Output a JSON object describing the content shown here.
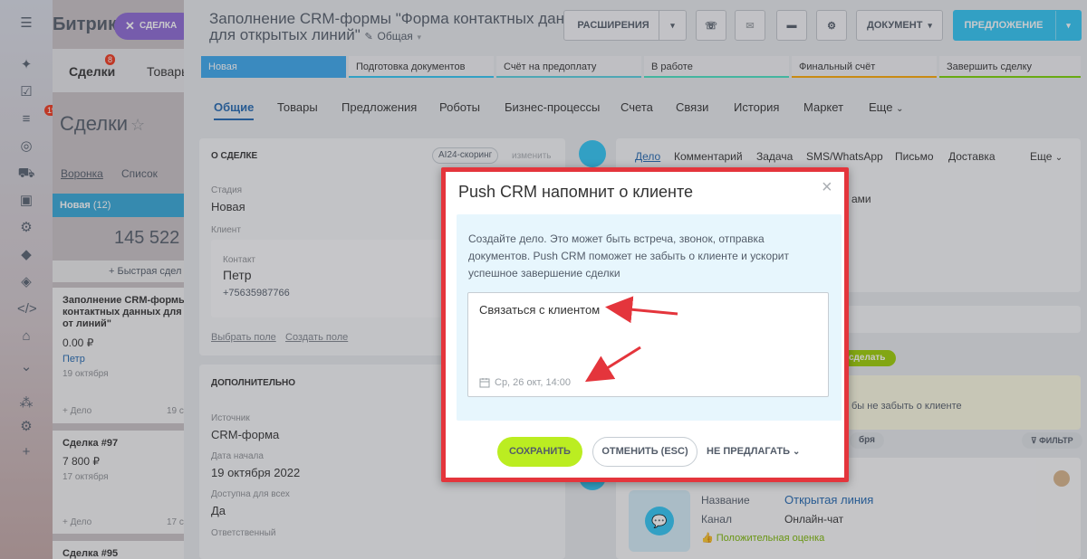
{
  "sidebar": {
    "badge": "19"
  },
  "kanban": {
    "app_name": "Битрикс",
    "deal_chip": "СДЕЛКА",
    "tab_deals": "Сделки",
    "tab_deals_badge": "8",
    "tab_goods": "Товары",
    "page_title": "Сделки",
    "view_funnel": "Воронка",
    "view_list": "Список",
    "column_name": "Новая",
    "column_count": "(12)",
    "column_sum": "145 522",
    "quick_deal": "+ Быстрая сдел",
    "cards": [
      {
        "title": "Заполнение CRM-формы контактных данных для от линий\"",
        "amount": "0.00 ₽",
        "client": "Петр",
        "date": "19 октября",
        "add": "+ Дело",
        "date_short": "19 с"
      },
      {
        "title": "Сделка #97",
        "amount": "7 800 ₽",
        "date": "17 октября",
        "add": "+ Дело",
        "date_short": "17 с"
      },
      {
        "title": "Сделка #95"
      }
    ]
  },
  "header": {
    "title_line1": "Заполнение CRM-формы \"Форма контактных данных",
    "title_line2": "для открытых линий\"",
    "category": "Общая",
    "btn_extensions": "РАСШИРЕНИЯ",
    "btn_document": "ДОКУМЕНТ",
    "btn_proposal": "ПРЕДЛОЖЕНИЕ"
  },
  "stages": [
    "Новая",
    "Подготовка документов",
    "Счёт на предоплату",
    "В работе",
    "Финальный счёт",
    "Завершить сделку"
  ],
  "tabs": [
    "Общие",
    "Товары",
    "Предложения",
    "Роботы",
    "Бизнес-процессы",
    "Счета",
    "Связи",
    "История",
    "Маркет",
    "Еще"
  ],
  "about": {
    "heading": "О СДЕЛКЕ",
    "ai_badge": "AI24-скоринг",
    "edit": "изменить",
    "stage_label": "Стадия",
    "stage_value": "Новая",
    "client_label": "Клиент",
    "contact_label": "Контакт",
    "contact_name": "Петр",
    "contact_phone": "+75635987766",
    "select_field": "Выбрать поле",
    "create_field": "Создать поле"
  },
  "extra": {
    "heading": "ДОПОЛНИТЕЛЬНО",
    "source_label": "Источник",
    "source_value": "CRM-форма",
    "start_label": "Дата начала",
    "start_value": "19 октября 2022",
    "access_label": "Доступна для всех",
    "access_value": "Да",
    "resp_label": "Ответственный"
  },
  "timeline": {
    "tabs": [
      "Дело",
      "Комментарий",
      "Задача",
      "SMS/WhatsApp",
      "Письмо",
      "Доставка",
      "Еще"
    ],
    "frag_ami": "ами",
    "frag_do": "сделать",
    "frag_hint": "бы не забыть о клиенте",
    "frag_date": "бря",
    "filter": "ФИЛЬТР",
    "name_label": "Название",
    "name_value": "Открытая линия",
    "channel_label": "Канал",
    "channel_value": "Онлайн-чат",
    "rating": "Положительная оценка"
  },
  "dialog": {
    "title": "Push CRM напомнит о клиенте",
    "hint": "Создайте дело. Это может быть встреча, звонок, отправка документов. Push CRM поможет не забыть о клиенте и ускорит успешное завершение сделки",
    "textarea_value": "Связаться с клиентом",
    "deadline": "Ср, 26 окт, 14:00",
    "save": "СОХРАНИТЬ",
    "cancel": "ОТМЕНИТЬ (ESC)",
    "no_suggest": "НЕ ПРЕДЛАГАТЬ"
  },
  "colors": {
    "accent_blue": "#2fc6f6",
    "highlight_red": "#e4353c",
    "save_green": "#bbed21"
  }
}
